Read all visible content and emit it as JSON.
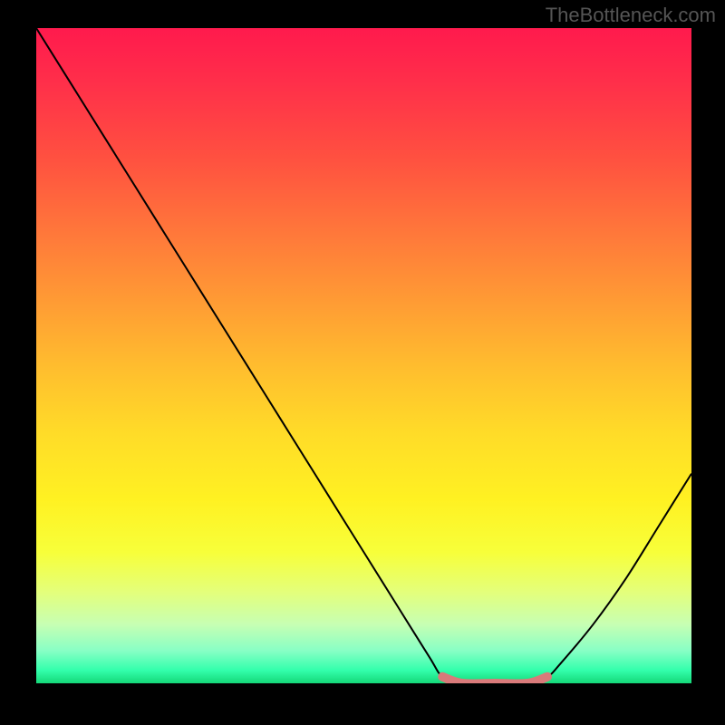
{
  "watermark": "TheBottleneck.com",
  "chart_data": {
    "type": "line",
    "title": "",
    "xlabel": "",
    "ylabel": "",
    "xlim": [
      0,
      100
    ],
    "ylim": [
      0,
      100
    ],
    "grid": false,
    "legend": false,
    "background_gradient": {
      "direction": "vertical",
      "stops": [
        {
          "pos": 0,
          "color": "#ff1a4d"
        },
        {
          "pos": 50,
          "color": "#ffdc28"
        },
        {
          "pos": 100,
          "color": "#15d878"
        }
      ],
      "meaning": "bottleneck severity (red high, green low)"
    },
    "series": [
      {
        "name": "bottleneck-curve",
        "color": "#000000",
        "x": [
          0,
          5,
          10,
          15,
          20,
          25,
          30,
          35,
          40,
          45,
          50,
          55,
          60,
          62,
          65,
          70,
          75,
          78,
          80,
          85,
          90,
          95,
          100
        ],
        "y": [
          100,
          92,
          84,
          76,
          68,
          60,
          52,
          44,
          36,
          28,
          20,
          12,
          4,
          1,
          0,
          0,
          0,
          1,
          3,
          9,
          16,
          24,
          32
        ]
      }
    ],
    "highlight": {
      "name": "optimal-range",
      "color": "#d97a7a",
      "x": [
        62,
        65,
        70,
        75,
        78
      ],
      "y": [
        1,
        0,
        0,
        0,
        1
      ]
    }
  }
}
